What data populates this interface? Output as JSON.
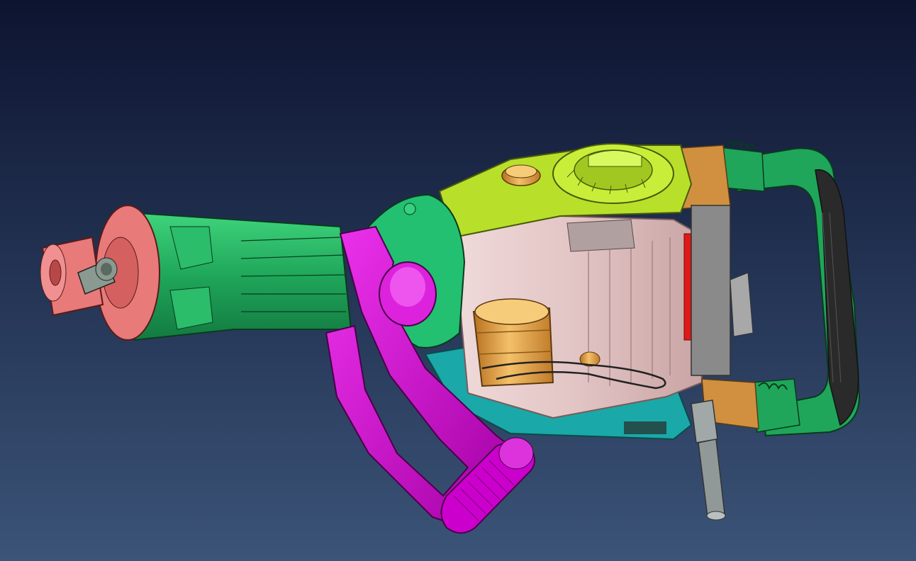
{
  "viewport": {
    "background_top": "#0d1430",
    "background_bottom": "#3b5478"
  },
  "model": {
    "parts": [
      {
        "name": "chuck-head",
        "color": "#e87a7a"
      },
      {
        "name": "barrel-housing",
        "color": "#1fa65a"
      },
      {
        "name": "side-handle",
        "color": "#cc00cc"
      },
      {
        "name": "gear-cover",
        "color": "#b8e02a"
      },
      {
        "name": "motor-housing",
        "color": "#e6caca"
      },
      {
        "name": "base-housing",
        "color": "#1aa8a8"
      },
      {
        "name": "rear-handle",
        "color": "#1fa65a"
      },
      {
        "name": "handle-grip",
        "color": "#2a2a2a"
      },
      {
        "name": "bearing-sleeve",
        "color": "#e8a040"
      },
      {
        "name": "bracket-pieces",
        "color": "#d09040"
      },
      {
        "name": "cable-gland",
        "color": "#909898"
      },
      {
        "name": "switch-trigger",
        "color": "#a8a8a8"
      },
      {
        "name": "brush-insert",
        "color": "#e01818"
      }
    ]
  }
}
